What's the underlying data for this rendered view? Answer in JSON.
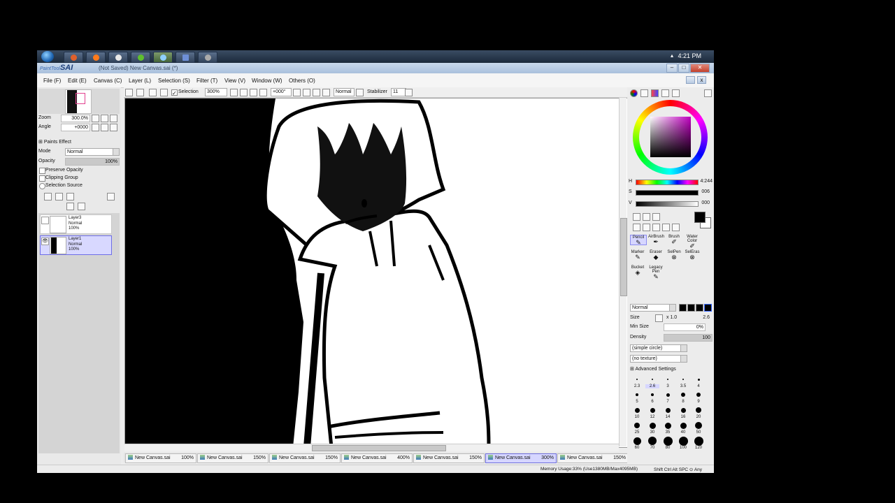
{
  "taskbar": {
    "time": "4:21 PM",
    "tray_icon": "▴"
  },
  "app": {
    "logo": "SAI",
    "logo_prefix": "PaintTool",
    "doc_title": "(Not Saved) New Canvas.sai (*)"
  },
  "menu": [
    "File (F)",
    "Edit (E)",
    "Canvas (C)",
    "Layer (L)",
    "Selection (S)",
    "Filter (T)",
    "View (V)",
    "Window (W)",
    "Others (O)"
  ],
  "toolbar": {
    "selection_label": "Selection",
    "zoom": "300%",
    "angle": "+000°",
    "blend": "Normal",
    "stabilizer_label": "Stabilizer",
    "stabilizer_value": "11"
  },
  "navigator": {
    "zoom_label": "Zoom",
    "zoom_value": "300.0%",
    "angle_label": "Angle",
    "angle_value": "+0000"
  },
  "layer_props": {
    "paints_effect": "Paints Effect",
    "mode_label": "Mode",
    "mode_value": "Normal",
    "opacity_label": "Opacity",
    "opacity_value": "100%",
    "preserve_opacity": "Preserve Opacity",
    "clipping_group": "Clipping Group",
    "selection_source": "Selection Source"
  },
  "layers": [
    {
      "name": "Layer3",
      "mode": "Normal",
      "opacity": "100%",
      "visible": false,
      "selected": false
    },
    {
      "name": "Layer1",
      "mode": "Normal",
      "opacity": "100%",
      "visible": true,
      "selected": true
    }
  ],
  "tabs": [
    {
      "name": "New Canvas.sai",
      "zoom": "100%",
      "active": false
    },
    {
      "name": "New Canvas.sai",
      "zoom": "150%",
      "active": false
    },
    {
      "name": "New Canvas.sai",
      "zoom": "150%",
      "active": false
    },
    {
      "name": "New Canvas.sai",
      "zoom": "400%",
      "active": false
    },
    {
      "name": "New Canvas.sai",
      "zoom": "150%",
      "active": false
    },
    {
      "name": "New Canvas.sai",
      "zoom": "300%",
      "active": true
    },
    {
      "name": "New Canvas.sai",
      "zoom": "150%",
      "active": false
    }
  ],
  "color": {
    "h_label": "H",
    "h_value": "4:244",
    "s_label": "S",
    "s_value": "006",
    "v_label": "V",
    "v_value": "000",
    "primary": "#000000",
    "secondary": "#ffffff"
  },
  "tools": {
    "row1": [
      "Pencil",
      "AirBrush",
      "Brush",
      "Water Color"
    ],
    "row2": [
      "Marker",
      "Eraser",
      "SelPen",
      "SelEras"
    ],
    "row3": [
      "Bucket",
      "Legacy Pen"
    ],
    "selected": "Pencil"
  },
  "brush": {
    "mode": "Normal",
    "size_label": "Size",
    "size_mult": "x 1.0",
    "size_value": "2.6",
    "minsize_label": "Min Size",
    "minsize_value": "0%",
    "density_label": "Density",
    "density_value": "100",
    "shape": "(simple circle)",
    "texture": "(no texture)",
    "advanced": "Advanced Settings",
    "presets": [
      "2.3",
      "2.6",
      "3",
      "3.5",
      "4",
      "5",
      "6",
      "7",
      "8",
      "9",
      "10",
      "12",
      "14",
      "16",
      "20",
      "25",
      "30",
      "35",
      "40",
      "50",
      "60",
      "70",
      "80",
      "100",
      "120"
    ]
  },
  "status": {
    "memory": "Memory Usage:33% (Use1380MB/Max4095MB)",
    "keys": "Shift Ctrl Alt SPC ⊙ Any"
  }
}
